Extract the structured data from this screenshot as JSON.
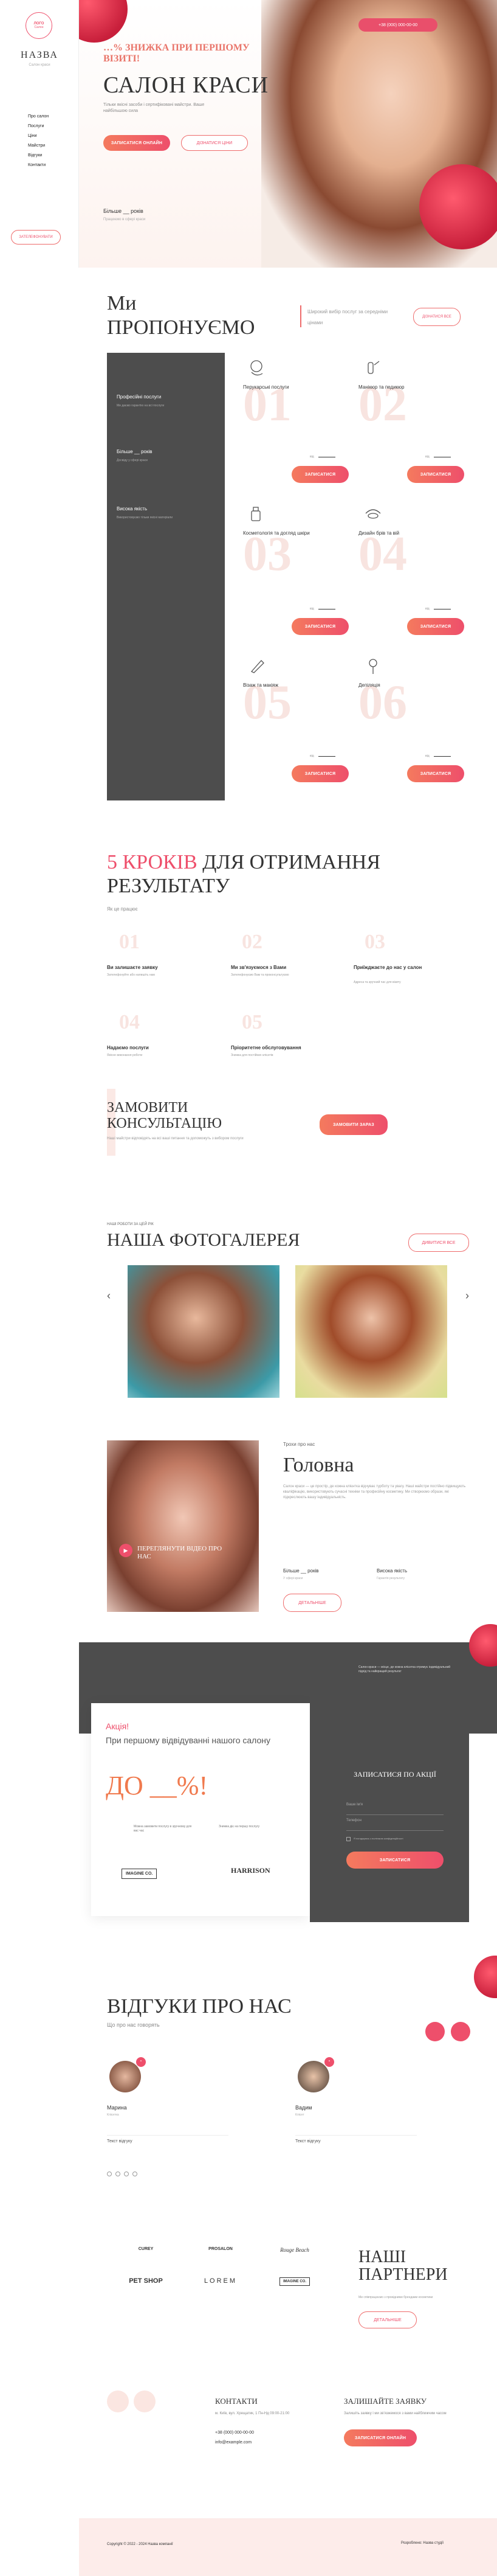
{
  "sidebar": {
    "logo_line1": "ЛОГО",
    "logo_line2": "Салон",
    "brand": "НАЗВА",
    "tagline": "Салон краси",
    "nav": [
      "Про салон",
      "Послуги",
      "Ціни",
      "Майстри",
      "Відгуки",
      "Контакти"
    ],
    "call_button": "ЗАТЕЛЕФОНУВАТИ"
  },
  "hero": {
    "phone": "+38 (000) 000-00-00",
    "promo": "…% ЗНИЖКА ПРИ ПЕРШОМУ ВІЗИТІ!",
    "title": "САЛОН КРАСИ",
    "subtitle": "Тільки якісні засоби і сертифіковані майстри. Ваше найбільшою сила",
    "book_button": "ЗАПИСАТИСЯ ОНЛАЙН",
    "price_button": "ДІЗНАТИСЯ ЦІНИ",
    "stat_value": "Більше __ років",
    "stat_label": "Працюємо в сфері краси",
    "accent": "#ee4f6b"
  },
  "offer": {
    "title_line1": "Ми",
    "title_line2": "пропонуємо",
    "subtitle": "Широкий вибір послуг за середніми цінами",
    "more_button": "ДІЗНАТИСЯ ВСЕ",
    "dark_items": [
      {
        "title": "Професійні послуги",
        "text": "Ми даємо гарантію на всі послуги"
      },
      {
        "title": "Більше __ років",
        "text": "Досвіду у сфері краси"
      },
      {
        "title": "Висока якість",
        "text": "Використовуємо тільки якісні матеріали"
      }
    ],
    "services": [
      {
        "num": "01",
        "title": "Перукарські послуги",
        "price": "від",
        "button": "ЗАПИСАТИСЯ",
        "icon": "hair-icon"
      },
      {
        "num": "02",
        "title": "Манікюр та педикюр",
        "price": "від",
        "button": "ЗАПИСАТИСЯ",
        "icon": "nails-icon"
      },
      {
        "num": "03",
        "title": "Косметологія та догляд шкіри",
        "price": "від",
        "button": "ЗАПИСАТИСЯ",
        "icon": "cosmetics-icon"
      },
      {
        "num": "04",
        "title": "Дизайн брів та вій",
        "price": "від",
        "button": "ЗАПИСАТИСЯ",
        "icon": "brows-icon"
      },
      {
        "num": "05",
        "title": "Візаж та макіяж",
        "price": "від",
        "button": "ЗАПИСАТИСЯ",
        "icon": "makeup-icon"
      },
      {
        "num": "06",
        "title": "Депіляція",
        "price": "від",
        "button": "ЗАПИСАТИСЯ",
        "icon": "depilation-icon"
      }
    ]
  },
  "steps": {
    "title_accent": "5 КРОКІВ",
    "title_rest": "ДЛЯ ОТРИМАННЯ",
    "title_line2": "РЕЗУЛЬТАТУ",
    "subtitle": "Як це працює",
    "items": [
      {
        "num": "01",
        "title": "Ви залишаєте заявку",
        "text": "Зателефонуйте або напишіть нам"
      },
      {
        "num": "02",
        "title": "Ми зв'язуємося з Вами",
        "text": "Зателефонуємо Вам та проконсультуємо"
      },
      {
        "num": "03",
        "title": "Приїжджаєте до нас у салон",
        "text": "Адреса та зручний час для візиту"
      },
      {
        "num": "04",
        "title": "Надаємо послуги",
        "text": "Якісне виконання роботи"
      },
      {
        "num": "05",
        "title": "Пріоритетне обслуговування",
        "text": "Знижка для постійних клієнтів"
      }
    ],
    "consult_title": "ЗАМОВИТИ КОНСУЛЬТАЦІЮ",
    "consult_text": "Наші майстри відповідять на всі ваші питання та допоможуть з вибором послуги",
    "consult_button": "ЗАМОВИТИ ЗАРАЗ"
  },
  "gallery": {
    "label": "НАШІ РОБОТИ ЗА ЦЕЙ РІК",
    "title": "НАША ФОТОГАЛЕРЕЯ",
    "button": "ДИВИТИСЯ ВСЕ"
  },
  "about": {
    "label": "Трохи про нас",
    "title": "Головна",
    "video_caption": "ПЕРЕГЛЯНУТИ ВІДЕО ПРО НАС",
    "text": "Салон краси — це простір, де кожна клієнтка відчуває турботу та увагу. Наші майстри постійно підвищують кваліфікацію, використовують сучасні техніки та професійну косметику. Ми створюємо образи, які підкреслюють вашу індивідуальність.",
    "stat1": "Більше __ років",
    "stat1_text": "У сфері краси",
    "stat2": "Висока якість",
    "stat2_text": "Гарантія результату",
    "button": "ДЕТАЛЬНІШЕ"
  },
  "promo": {
    "label": "Акція!",
    "text": "При першому відвідуванні нашого салону",
    "big": "ДО __%!",
    "feat1": "Можна замовити послугу в зручному для вас час",
    "feat2": "Знижка діє на першу послугу",
    "logo1": "IMAGINE CO.",
    "logo2": "HARRISON",
    "form_intro": "Салон краси — місце, де кожна клієнтка отримує індивідуальний підхід та найкращий результат",
    "form_title": "ЗАПИСАТИСЯ ПО АКЦІЇ",
    "form_name": "Ваше ім'я",
    "form_phone": "Телефон",
    "form_agree": "Я погоджуюсь з політикою конфіденційності",
    "form_button": "ЗАПИСАТИСЯ"
  },
  "reviews": {
    "title": "ВІДГУКИ ПРО НАС",
    "subtitle": "Що про нас говорять",
    "items": [
      {
        "name": "Марина",
        "role": "Клієнтка",
        "text": "Текст відгуку"
      },
      {
        "name": "Вадим",
        "role": "Клієнт",
        "text": "Текст відгуку"
      }
    ]
  },
  "partners": {
    "title_line1": "НАШІ",
    "title_line2": "ПАРТНЕРИ",
    "text": "Ми співпрацюємо з провідними брендами косметики",
    "button": "ДЕТАЛЬНІШЕ",
    "logos": [
      "CUREY",
      "PROSALON",
      "Rouge Beach",
      "PET SHOP",
      "LOREM",
      "IMAGINE CO."
    ]
  },
  "footer": {
    "contacts_title": "КОНТАКТИ",
    "contacts_text": "м. Київ, вул. Хрещатик, 1 Пн-Нд 09:00-21:00",
    "phone": "+38 (000) 000-00-00",
    "email": "info@example.com",
    "cta_title": "ЗАЛИШАЙТЕ ЗАЯВКУ",
    "cta_text": "Залишіть заявку і ми зв'язжемося з вами найближчим часом",
    "cta_button": "ЗАПИСАТИСЯ ОНЛАЙН",
    "copyright": "Copyright © 2022 - 2024 Назва компанії",
    "policy": "Розроблено: Назва студії"
  }
}
